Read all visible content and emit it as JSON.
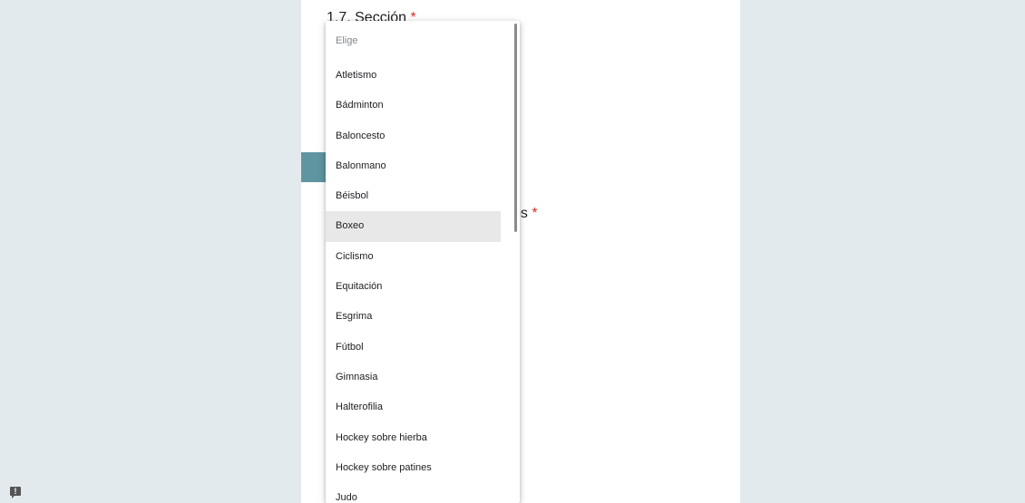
{
  "form": {
    "section_title": "1.7. Sección",
    "required_mark": "*",
    "question_fragment": "os"
  },
  "dropdown": {
    "placeholder": "Elige",
    "selected": "Boxeo",
    "options": [
      "Atletismo",
      "Bádminton",
      "Baloncesto",
      "Balonmano",
      "Béisbol",
      "Boxeo",
      "Ciclismo",
      "Equitación",
      "Esgrima",
      "Fútbol",
      "Gimnasia",
      "Halterofilia",
      "Hockey sobre hierba",
      "Hockey sobre patines",
      "Judo"
    ]
  },
  "feedback": {
    "icon": "feedback-icon",
    "glyph": "!"
  },
  "colors": {
    "page_bg": "#e3eaee",
    "accent": "#5e95a1",
    "required": "#d93025",
    "selected_bg": "#e8e8e8"
  }
}
